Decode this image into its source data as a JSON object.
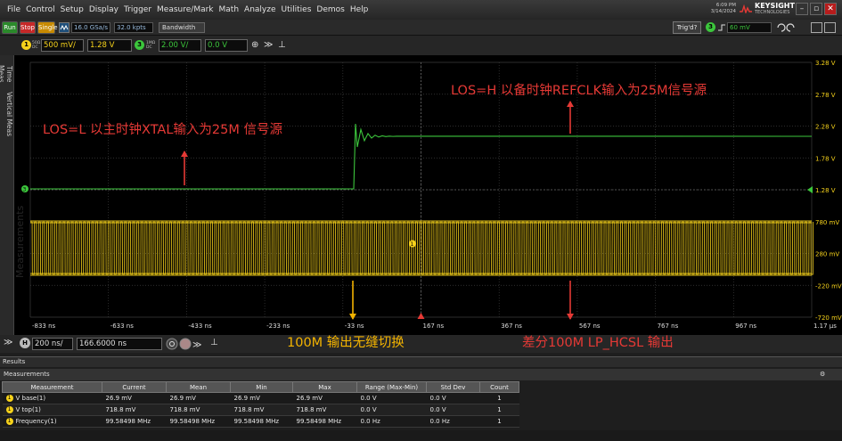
{
  "menu": {
    "items": [
      "File",
      "Control",
      "Setup",
      "Display",
      "Trigger",
      "Measure/Mark",
      "Math",
      "Analyze",
      "Utilities",
      "Demos",
      "Help"
    ],
    "time": "6:09 PM",
    "date": "3/14/2024",
    "brand": "KEYSIGHT",
    "brand_sub": "TECHNOLOGIES"
  },
  "toolbar": {
    "run_label": "Run",
    "stop_label": "Stop",
    "single_label": "Single",
    "sample_rate": "16.0 GSa/s",
    "memory_depth": "32.0 kpts",
    "bandwidth_label": "Bandwidth",
    "trig_label": "Trig'd?",
    "trigger_level": "60 mV"
  },
  "channels": {
    "ch1": {
      "number": "1",
      "coupling": "50Ω DC",
      "scale": "500 mV/",
      "offset": "1.28 V",
      "color": "#f6d21b"
    },
    "ch3": {
      "number": "3",
      "coupling": "1MΩ DC",
      "scale": "2.00 V/",
      "offset": "0.0 V",
      "color": "#3cc63c"
    }
  },
  "side_tabs": [
    "Time Meas",
    "Vertical Meas"
  ],
  "plot": {
    "watermark": "Measurements",
    "right_axis_labels": [
      "3.28 V",
      "2.78 V",
      "2.28 V",
      "1.78 V",
      "1.28 V",
      "780 mV",
      "280 mV",
      "-220 mV",
      "-720 mV"
    ],
    "time_labels": [
      "-833 ns",
      "-633 ns",
      "-433 ns",
      "-233 ns",
      "-33 ns",
      "167 ns",
      "367 ns",
      "567 ns",
      "767 ns",
      "967 ns",
      "1.17 µs"
    ],
    "ch1_marker": "1",
    "ch3_marker": "3",
    "trace_colors": {
      "clock": "#f6d21b",
      "los": "#3cc63c",
      "grid": "#3c3c3c",
      "annotation": "#e53935"
    }
  },
  "annotations": {
    "los_low": "LOS=L 以主时钟XTAL输入为25M 信号源",
    "los_high": "LOS=H 以备时钟REFCLK输入为25M信号源",
    "seamless": "100M 输出无缝切换",
    "diff_out": "差分100M LP_HCSL 输出"
  },
  "horizontal": {
    "badge": "H",
    "time_scale": "200 ns/",
    "position": "166.6000 ns"
  },
  "results": {
    "title": "Results",
    "tab": "Measurements",
    "headers": [
      "Measurement",
      "Current",
      "Mean",
      "Min",
      "Max",
      "Range (Max-Min)",
      "Std Dev",
      "Count"
    ],
    "rows": [
      {
        "src": "1",
        "cells": [
          "V base(1)",
          "26.9 mV",
          "26.9 mV",
          "26.9 mV",
          "26.9 mV",
          "0.0 V",
          "0.0 V",
          "1"
        ]
      },
      {
        "src": "1",
        "cells": [
          "V top(1)",
          "718.8 mV",
          "718.8 mV",
          "718.8 mV",
          "718.8 mV",
          "0.0 V",
          "0.0 V",
          "1"
        ]
      },
      {
        "src": "1",
        "cells": [
          "Frequency(1)",
          "99.58498 MHz",
          "99.58498 MHz",
          "99.58498 MHz",
          "99.58498 MHz",
          "0.0 Hz",
          "0.0 Hz",
          "1"
        ]
      }
    ]
  }
}
